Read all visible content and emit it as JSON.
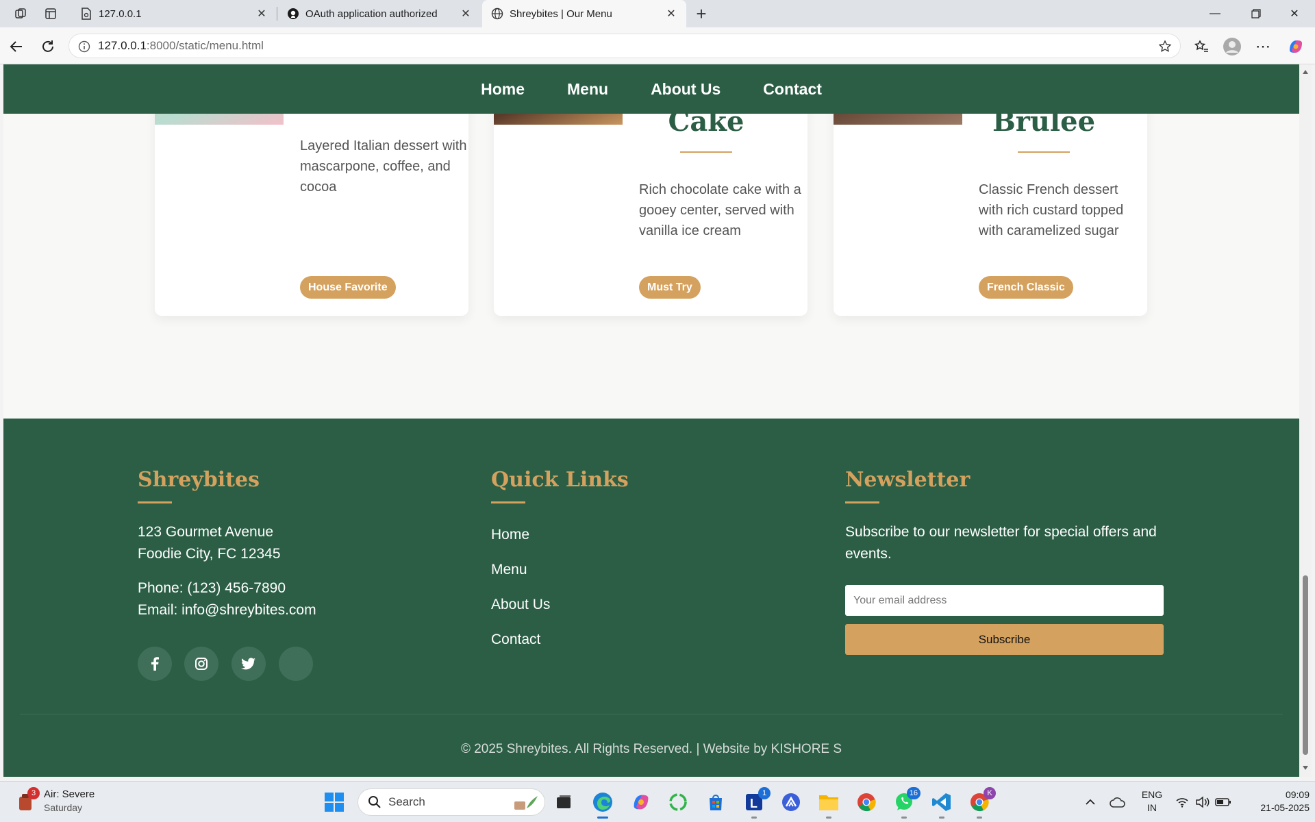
{
  "browser": {
    "tabs": [
      {
        "title": "127.0.0.1",
        "icon": "file-icon",
        "active": false
      },
      {
        "title": "OAuth application authorized",
        "icon": "github-icon",
        "active": false
      },
      {
        "title": "Shreybites | Our Menu",
        "icon": "globe-icon",
        "active": true
      }
    ],
    "url_host": "127.0.0.1",
    "url_path": ":8000/static/menu.html"
  },
  "site_nav": {
    "home": "Home",
    "menu": "Menu",
    "about": "About Us",
    "contact": "Contact"
  },
  "cards": [
    {
      "title": "",
      "desc": "Layered Italian dessert with mascarpone, coffee, and cocoa",
      "badge": "House Favorite"
    },
    {
      "title": "Cake",
      "desc": "Rich chocolate cake with a gooey center, served with vanilla ice cream",
      "badge": "Must Try"
    },
    {
      "title": "Brûlée",
      "desc": "Classic French dessert with rich custard topped with caramelized sugar",
      "badge": "French Classic"
    }
  ],
  "footer": {
    "brand": {
      "heading": "Shreybites",
      "address_line1": "123 Gourmet Avenue",
      "address_line2": "Foodie City, FC 12345",
      "phone": "Phone: (123) 456-7890",
      "email": "Email: info@shreybites.com",
      "social_icons": [
        "facebook-icon",
        "instagram-icon",
        "twitter-icon",
        "blank-social-icon"
      ]
    },
    "quick_links": {
      "heading": "Quick Links",
      "items": [
        "Home",
        "Menu",
        "About Us",
        "Contact"
      ]
    },
    "newsletter": {
      "heading": "Newsletter",
      "text": "Subscribe to our newsletter for special offers and events.",
      "placeholder": "Your email address",
      "button": "Subscribe"
    },
    "copyright": "© 2025 Shreybites. All Rights Reserved. | Website by KISHORE S"
  },
  "taskbar": {
    "weather_title": "Air: Severe",
    "weather_sub": "Saturday",
    "weather_badge": "3",
    "search_placeholder": "Search",
    "outlook_badge": "1",
    "whatsapp_badge": "16",
    "chrome_badge": "K",
    "lang_line1": "ENG",
    "lang_line2": "IN",
    "time": "09:09",
    "date": "21-05-2025"
  },
  "colors": {
    "brand_green": "#2b5e45",
    "accent_gold": "#d4a15e"
  }
}
